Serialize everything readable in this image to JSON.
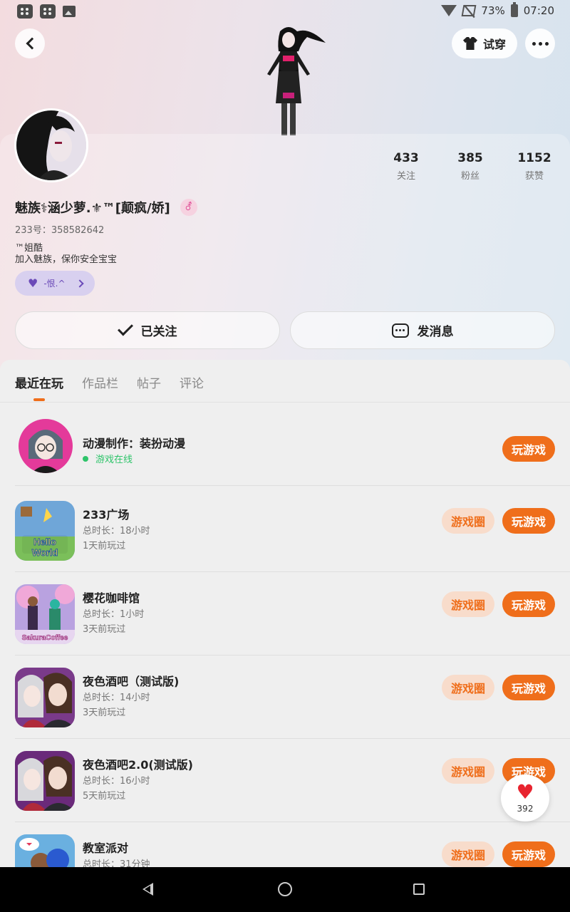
{
  "status_bar": {
    "battery": "73%",
    "time": "07:20"
  },
  "header": {
    "try_on_label": "试穿"
  },
  "profile": {
    "nickname": "魅族⚕涵少萝.⚜™[颠疯/娇]",
    "gender_symbol": "⚦",
    "uid": "233号：358582642",
    "bio_line1": "™姐酷",
    "bio_line2": "加入魅族，保你安全宝宝",
    "tag_label": "-恨.^",
    "stats": [
      {
        "value": "433",
        "label": "关注"
      },
      {
        "value": "385",
        "label": "粉丝"
      },
      {
        "value": "1152",
        "label": "获赞"
      }
    ],
    "follow_label": "已关注",
    "message_label": "发消息"
  },
  "tabs": [
    "最近在玩",
    "作品栏",
    "帖子",
    "评论"
  ],
  "games": [
    {
      "title": "动漫制作：装扮动漫",
      "status": "游戏在线",
      "play_label": "玩游戏"
    },
    {
      "title": "233广场",
      "duration": "总时长：18小时",
      "last_played": "1天前玩过",
      "circle_label": "游戏圈",
      "play_label": "玩游戏"
    },
    {
      "title": "樱花咖啡馆",
      "duration": "总时长：1小时",
      "last_played": "3天前玩过",
      "circle_label": "游戏圈",
      "play_label": "玩游戏"
    },
    {
      "title": "夜色酒吧（测试版)",
      "duration": "总时长：14小时",
      "last_played": "3天前玩过",
      "circle_label": "游戏圈",
      "play_label": "玩游戏"
    },
    {
      "title": "夜色酒吧2.0(测试版)",
      "duration": "总时长：16小时",
      "last_played": "5天前玩过",
      "circle_label": "游戏圈",
      "play_label": "玩游戏"
    },
    {
      "title": "教室派对",
      "duration": "总时长：31分钟",
      "circle_label": "游戏圈",
      "play_label": "玩游戏"
    }
  ],
  "thumb_text": {
    "hello_world": "Hello World",
    "sakura": "SakuraCoffee"
  },
  "like_count": "392",
  "colors": {
    "accent": "#ef6e1b",
    "online": "#2ec46a",
    "like": "#e8242f"
  }
}
